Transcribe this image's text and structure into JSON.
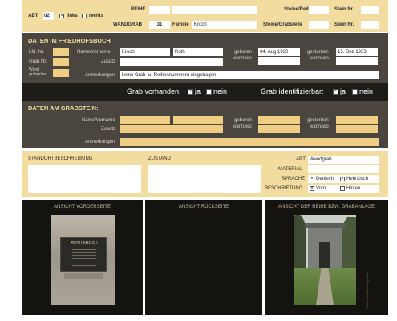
{
  "top": {
    "abt_label": "ABT.",
    "abt_value": "02",
    "links_label": "links",
    "rechts_label": "rechts",
    "reihe_label": "REIHE",
    "wandgrab_label": "WANDGRAB",
    "wandgrab_value": "31",
    "familie_label": "Familie",
    "familie_value": "Kroch",
    "steine_reihe_label": "Steine/Reihe",
    "stein_nr_label": "Stein Nr.",
    "steine_grabstelle_label": "Steine/Grabstelle",
    "stein_nr2_label": "Stein Nr."
  },
  "friedhofsbuch": {
    "title": "DATEN IM FRIEDHOFSBUCH",
    "lfd_nr_label": "Lfd. Nr.",
    "grab_nr_label": "Grab Nr.",
    "wand_label": "Wand grabreihe",
    "name_label": "Name/Vorname",
    "name_value": "Kroch",
    "vorname_value": "Ruth",
    "zusatz_label": "Zusatz",
    "anm_label": "Anmerkungen",
    "anm_value": "keine Grab- u. Reihennummern eingetragen",
    "geboren_label": "geboren",
    "geboren_value": "04. Aug 1920",
    "gestorben_label": "gestorben",
    "gestorben_value": "15. Dez 1933",
    "wannwo1": "wann/wo",
    "wannwo2": "wann/wo",
    "grab_vorhanden_label": "Grab vorhanden:",
    "ja1": "ja",
    "nein1": "nein",
    "grab_ident_label": "Grab identifizierbar:",
    "ja2": "ja",
    "nein2": "nein"
  },
  "grabstein": {
    "title": "DATEN AM GRABSTEIN:",
    "name_label": "Name/Vorname",
    "zusatz_label": "Zusatz",
    "anm_label": "Anmerkungen",
    "geboren_label": "geboren",
    "gestorben_label": "gestorben",
    "wannwo1": "wann/wo",
    "wannwo2": "wann/wo"
  },
  "standort": {
    "standort_label": "STANDORTBESCHREIBUNG",
    "zustand_label": "ZUSTAND",
    "art_label": "ART",
    "art_value": "Wandgrab",
    "material_label": "MATERIAL",
    "sprache_label": "SPRACHE",
    "deutsch": "Deutsch",
    "hebraeisch": "Hebräisch",
    "beschriftung_label": "BESCHRIFTUNG",
    "vorn": "Vorn",
    "hinten": "Hinten"
  },
  "photos": {
    "vorderseite": "ANSICHT VORDERSEITE",
    "rueckseite": "ANSICHT RÜCKSEITE",
    "reihe": "ANSICHT DER REIHE BZW. GRABANLAGE",
    "plaque_name": "RUTH KROCH",
    "credit": "Photos © Ulrike Hagedorn"
  },
  "colors": {
    "beige": "#f3dca0",
    "dark": "#4a463f",
    "orange": "#f0cf85",
    "accent": "#e8b64c"
  }
}
